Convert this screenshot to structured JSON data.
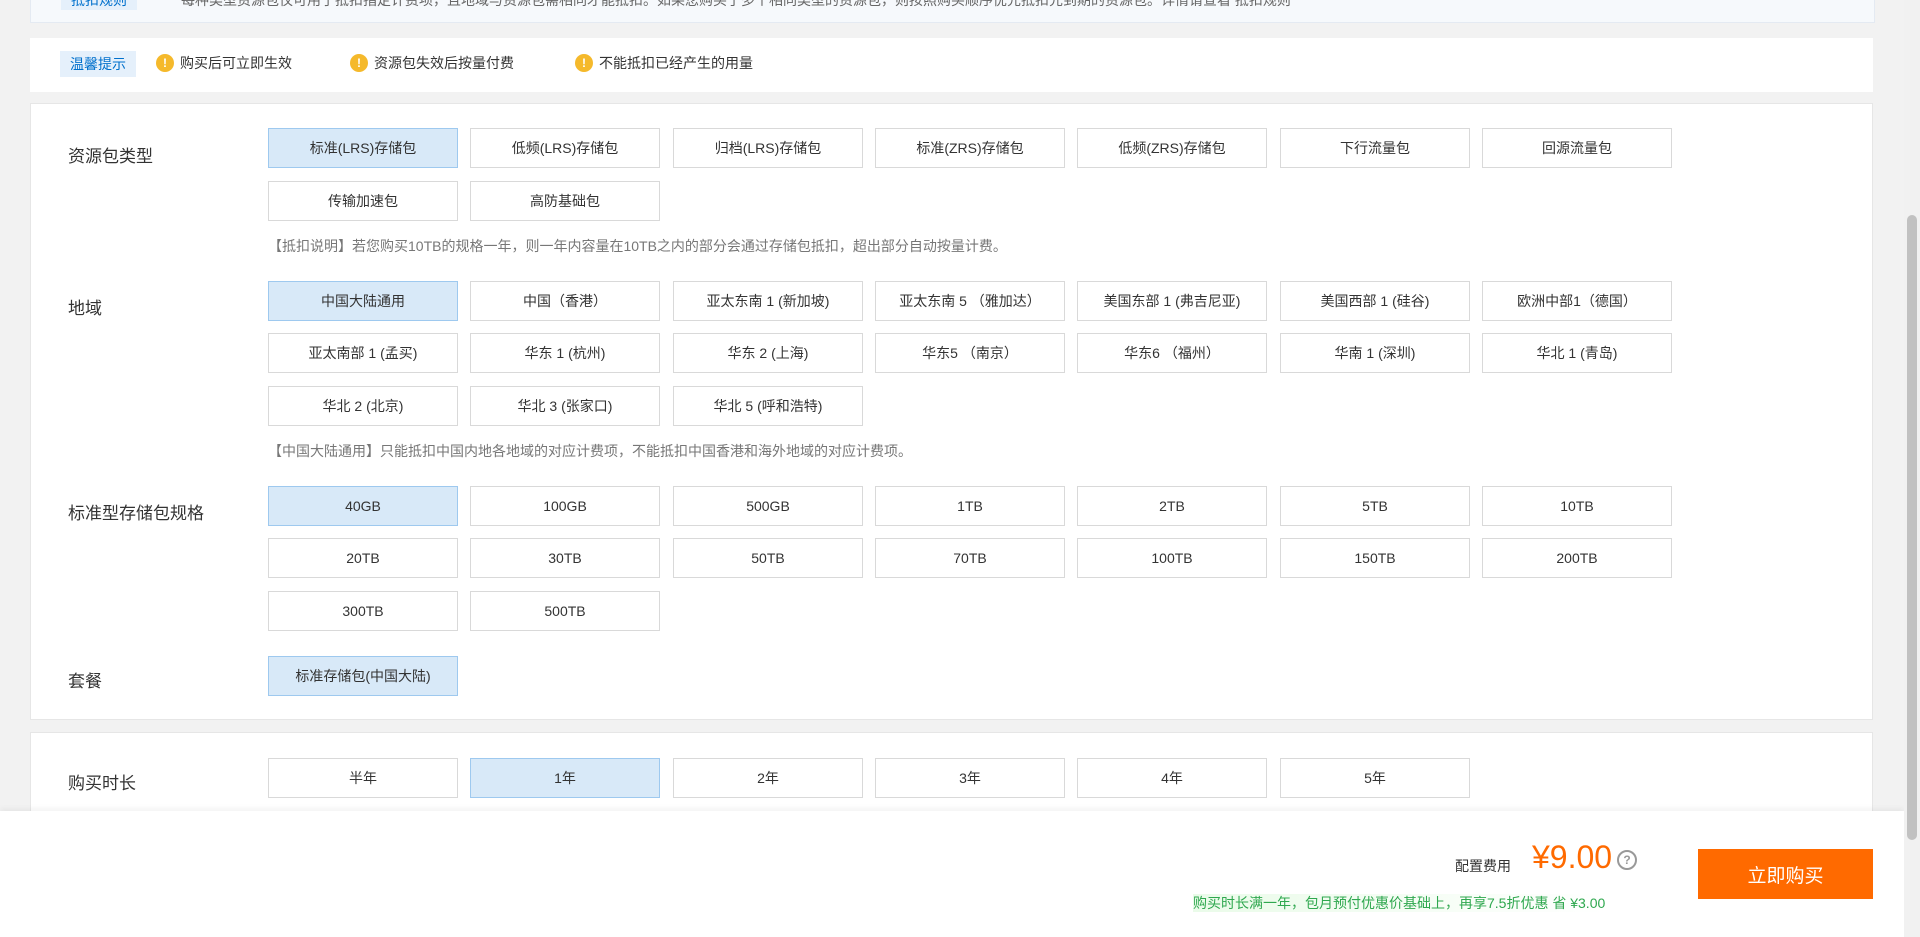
{
  "notice": {
    "badge": "抵扣规则",
    "text": "每种类型资源包仅可用于抵扣指定计费项，且地域与资源包需相同才能抵扣。如果您购买了多个相同类型的资源包，则按照购买顺序优先抵扣先到期的资源包。详情请查看 抵扣规则"
  },
  "tips": {
    "label": "温馨提示",
    "items": [
      "购买后可立即生效",
      "资源包失效后按量付费",
      "不能抵扣已经产生的用量"
    ]
  },
  "package_type": {
    "label": "资源包类型",
    "options": [
      "标准(LRS)存储包",
      "低频(LRS)存储包",
      "归档(LRS)存储包",
      "标准(ZRS)存储包",
      "低频(ZRS)存储包",
      "下行流量包",
      "回源流量包",
      "传输加速包",
      "高防基础包"
    ],
    "selected": "标准(LRS)存储包",
    "note": "【抵扣说明】若您购买10TB的规格一年，则一年内容量在10TB之内的部分会通过存储包抵扣，超出部分自动按量计费。"
  },
  "region": {
    "label": "地域",
    "options": [
      "中国大陆通用",
      "中国（香港）",
      "亚太东南 1 (新加坡)",
      "亚太东南 5 （雅加达）",
      "美国东部 1 (弗吉尼亚)",
      "美国西部 1 (硅谷)",
      "欧洲中部1（德国）",
      "亚太南部 1 (孟买)",
      "华东 1 (杭州)",
      "华东 2 (上海)",
      "华东5 （南京）",
      "华东6 （福州）",
      "华南 1 (深圳)",
      "华北 1 (青岛)",
      "华北 2 (北京)",
      "华北 3 (张家口)",
      "华北 5 (呼和浩特)"
    ],
    "selected": "中国大陆通用",
    "note": "【中国大陆通用】只能抵扣中国内地各地域的对应计费项，不能抵扣中国香港和海外地域的对应计费项。"
  },
  "spec": {
    "label": "标准型存储包规格",
    "options": [
      "40GB",
      "100GB",
      "500GB",
      "1TB",
      "2TB",
      "5TB",
      "10TB",
      "20TB",
      "30TB",
      "50TB",
      "70TB",
      "100TB",
      "150TB",
      "200TB",
      "300TB",
      "500TB"
    ],
    "selected": "40GB"
  },
  "plan": {
    "label": "套餐",
    "options": [
      "标准存储包(中国大陆)"
    ],
    "selected": "标准存储包(中国大陆)"
  },
  "duration": {
    "label": "购买时长",
    "options": [
      "半年",
      "1年",
      "2年",
      "3年",
      "4年",
      "5年"
    ],
    "selected": "1年"
  },
  "footer": {
    "fee_label": "配置费用",
    "price": "¥9.00",
    "promo": "购买时长满一年，包月预付优惠价基础上，再享7.5折优惠 省 ¥3.00",
    "buy_button": "立即购买",
    "help_icon": "question-circle-icon",
    "help_text": "?"
  },
  "colors": {
    "accent": "#ff6a00",
    "selected_bg": "#d8e9f8",
    "link": "#0070cc",
    "promo": "#2fa84f",
    "warn": "#f5b92b"
  }
}
